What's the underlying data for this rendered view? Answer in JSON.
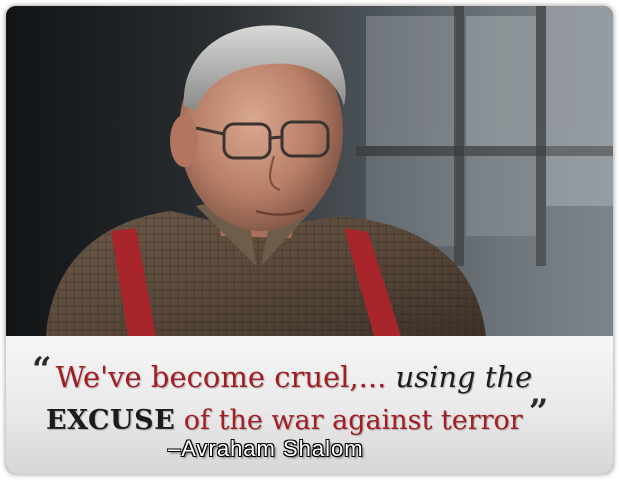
{
  "quote": {
    "open_mark": "“",
    "part1": "We've become cruel,...",
    "part2": "using the",
    "part3": "EXCUSE",
    "part4": "of the war against terror",
    "close_mark": "”"
  },
  "attribution": "–Avraham Shalom",
  "colors": {
    "quote_red": "#a31d22",
    "quote_dark": "#1d1d1d",
    "suspenders": "#a8262b",
    "caption_bg": "#ececec"
  }
}
